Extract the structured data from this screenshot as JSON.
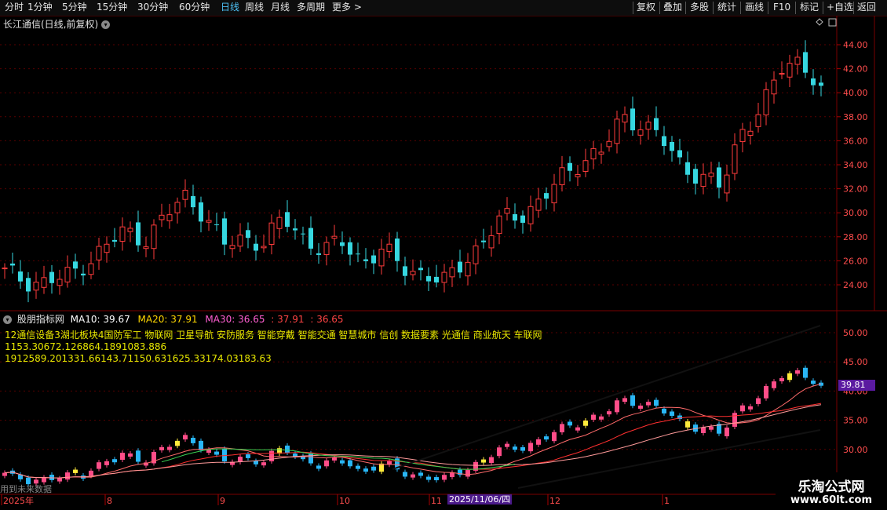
{
  "toolbar": {
    "left_tabs": [
      "分时",
      "1分钟",
      "5分钟",
      "15分钟",
      "30分钟",
      "60分钟",
      "日线",
      "周线",
      "月线",
      "多周期",
      "更多"
    ],
    "active_tab": "日线",
    "right_buttons": [
      "复权",
      "叠加",
      "多股",
      "统计",
      "画线",
      "F10",
      "标记",
      "+自选",
      "返回"
    ]
  },
  "main_chart": {
    "title": "长江通信(日线,前复权)",
    "y_ticks": [
      "44.00",
      "42.00",
      "40.00",
      "38.00",
      "36.00",
      "34.00",
      "32.00",
      "30.00",
      "28.00",
      "26.00",
      "24.00"
    ]
  },
  "indicator": {
    "name": "股朋指标网",
    "ma10": "MA10: 39.67",
    "ma20": "MA20: 37.91",
    "ma30": "MA30: 36.65",
    "extra1": ": 37.91",
    "extra2": ": 36.65",
    "line1": "12通信设备3湖北板块4国防军工 物联网 卫星导航 安防服务 智能穿戴 智能交通 智慧城市 信创 数据要素 光通信 商业航天 车联网",
    "line2": "1153.30672.126864.1891083.886",
    "line3": "1912589.201331.66143.71150.631625.33174.03183.63",
    "y_ticks": [
      "50.00",
      "45.00",
      "40.00",
      "35.00",
      "30.00"
    ],
    "price_tag": "39.81",
    "overlay_label": "用到未来数据"
  },
  "x_axis": {
    "labels": [
      "2025年",
      "8",
      "9",
      "10",
      "11",
      "12",
      "1"
    ],
    "selected_date": "2025/11/06/四"
  },
  "watermark": {
    "line1": "乐淘公式网",
    "line2": "www.60lt.com"
  },
  "colors": {
    "up": "#ff3b3b",
    "down": "#36d7e0",
    "ma10": "#ffffff",
    "ma20": "#ffd700",
    "ma30": "#ff5fd2",
    "grid": "#5a0000",
    "accent": "#4fc3f7"
  },
  "chart_data": {
    "type": "candlestick",
    "title": "长江通信(日线,前复权)",
    "ylim": [
      23,
      45
    ],
    "x_labels": [
      "2025年",
      "8",
      "9",
      "10",
      "11",
      "12",
      "1"
    ],
    "close_series_approx": [
      25.0,
      24.4,
      24.2,
      24.5,
      25.8,
      27.0,
      28.5,
      27.8,
      29.4,
      31.5,
      30.0,
      27.2,
      28.0,
      27.5,
      29.5,
      28.0,
      26.8,
      27.5,
      26.0,
      26.8,
      25.5,
      25.0,
      24.0,
      26.0,
      27.5,
      29.5,
      30.0,
      31.0,
      33.0,
      34.5,
      35.0,
      38.0,
      37.5,
      36.0,
      34.0,
      33.0,
      32.0,
      37.0,
      38.5,
      42.0,
      43.0,
      39.8
    ]
  }
}
